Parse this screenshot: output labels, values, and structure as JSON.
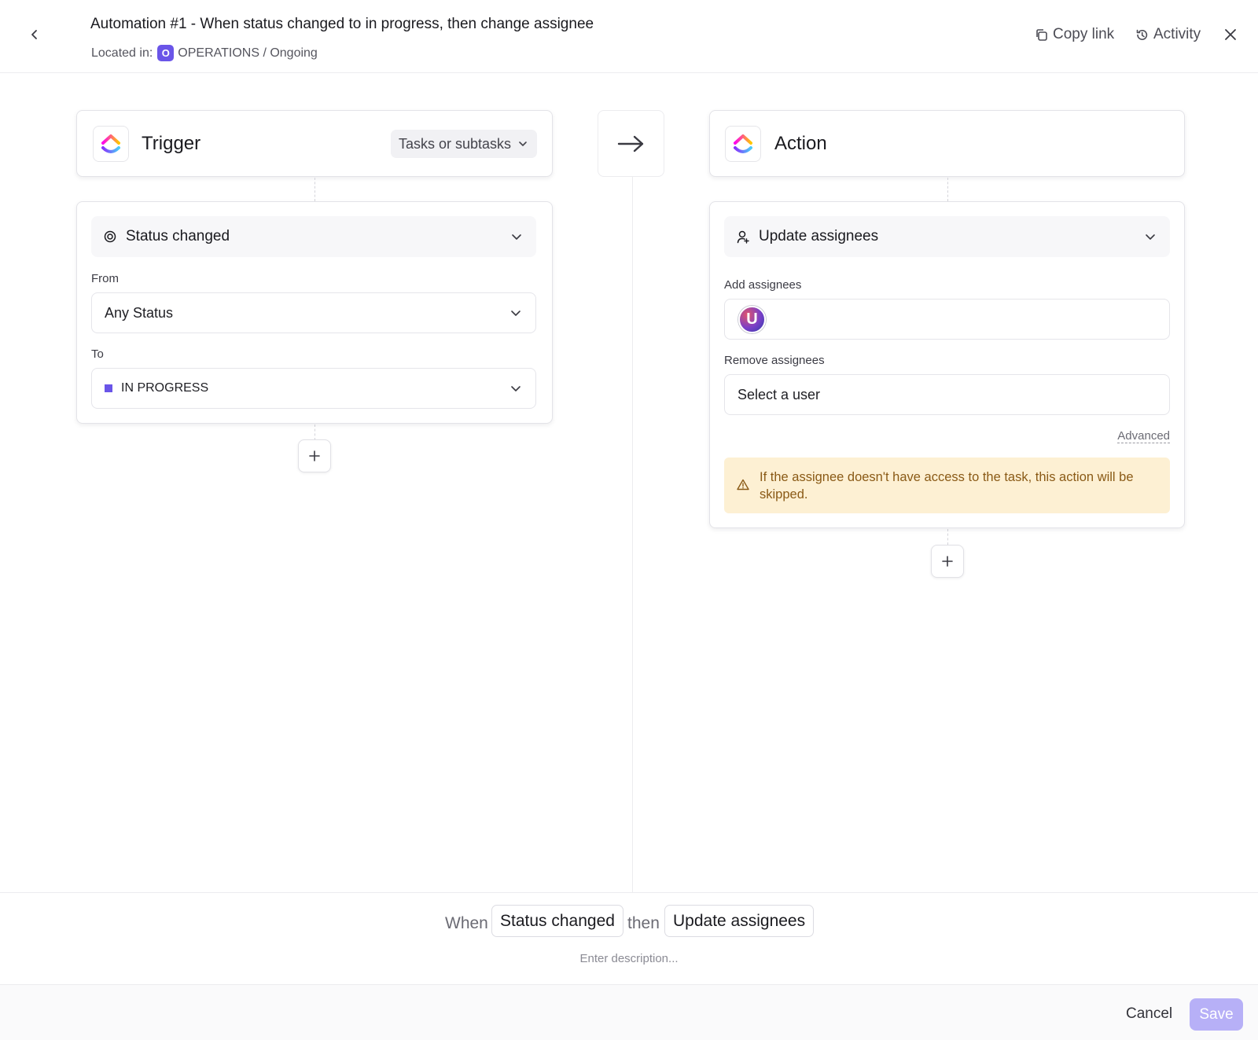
{
  "header": {
    "title": "Automation #1 - When status changed to in progress, then change assignee",
    "location_label": "Located in:",
    "space_initial": "O",
    "location_path": "OPERATIONS / Ongoing",
    "copy_link": "Copy link",
    "activity": "Activity"
  },
  "trigger": {
    "title": "Trigger",
    "scope": "Tasks or subtasks",
    "event": "Status changed",
    "from_label": "From",
    "from_value": "Any Status",
    "to_label": "To",
    "to_value": "IN PROGRESS",
    "to_color": "#6a55e8"
  },
  "action": {
    "title": "Action",
    "event": "Update assignees",
    "add_label": "Add assignees",
    "avatar_initial": "U",
    "remove_label": "Remove assignees",
    "remove_placeholder": "Select a user",
    "advanced": "Advanced",
    "warning": "If the assignee doesn't have access to the task, this action will be skipped."
  },
  "summary": {
    "when": "When",
    "trigger": "Status changed",
    "then": "then",
    "action": "Update assignees",
    "description_placeholder": "Enter description..."
  },
  "footer": {
    "cancel": "Cancel",
    "save": "Save"
  },
  "colors": {
    "accent": "#6a55e8",
    "save_disabled": "#b7b0f7",
    "warning_bg": "#fdf0d3",
    "warning_text": "#8a5a16"
  }
}
